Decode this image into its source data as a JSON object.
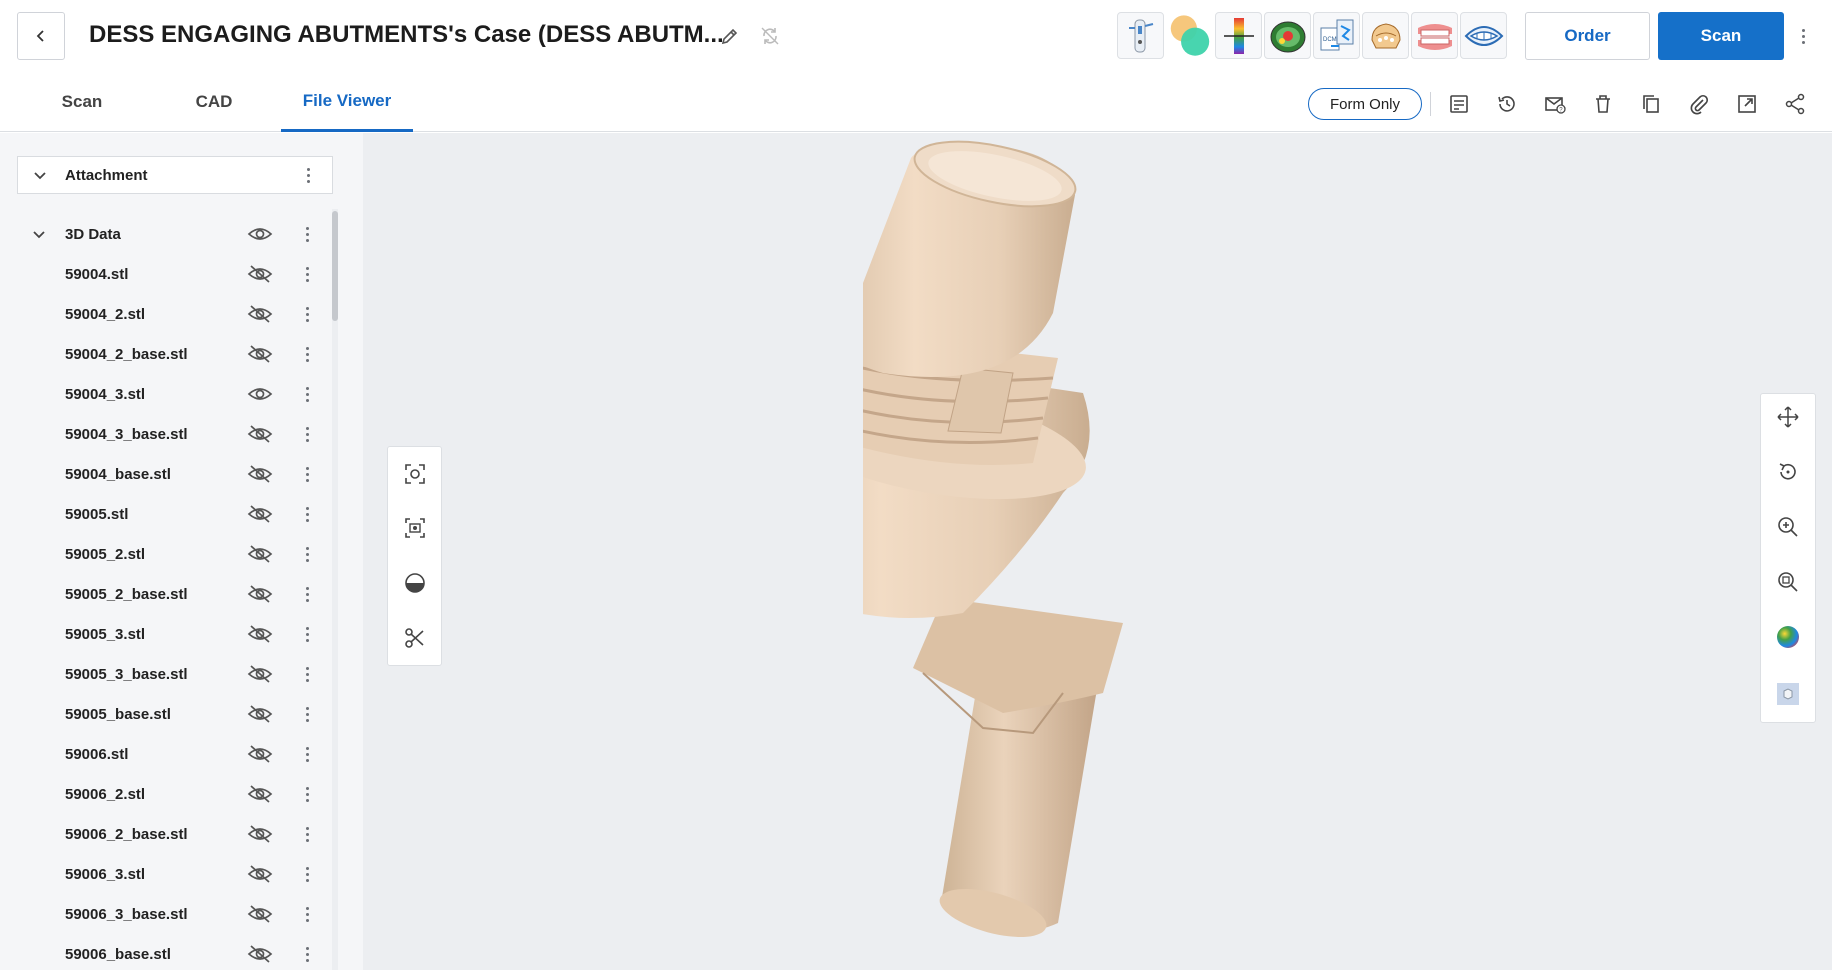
{
  "header": {
    "title": "DESS ENGAGING ABUTMENTS's Case (DESS ABUTM...",
    "order_label": "Order",
    "scan_label": "Scan",
    "apps": [
      "tooth-scan-app",
      "color-orbs-app",
      "spectrum-app",
      "heatmap-app",
      "dicom-app",
      "model-builder-app",
      "denture-app",
      "smile-app"
    ]
  },
  "tabs": [
    {
      "label": "Scan",
      "active": false
    },
    {
      "label": "CAD",
      "active": false
    },
    {
      "label": "File Viewer",
      "active": true
    }
  ],
  "toolbar": {
    "form_only_label": "Form Only",
    "icons": [
      "note-icon",
      "history-icon",
      "mail-icon",
      "trash-icon",
      "copy-icon",
      "attachment-icon",
      "open-external-icon",
      "share-icon"
    ]
  },
  "sidebar": {
    "attachment_label": "Attachment",
    "folder_label": "3D Data",
    "files": [
      {
        "name": "59004.stl",
        "visible": false
      },
      {
        "name": "59004_2.stl",
        "visible": false
      },
      {
        "name": "59004_2_base.stl",
        "visible": false
      },
      {
        "name": "59004_3.stl",
        "visible": true
      },
      {
        "name": "59004_3_base.stl",
        "visible": false
      },
      {
        "name": "59004_base.stl",
        "visible": false
      },
      {
        "name": "59005.stl",
        "visible": false
      },
      {
        "name": "59005_2.stl",
        "visible": false
      },
      {
        "name": "59005_2_base.stl",
        "visible": false
      },
      {
        "name": "59005_3.stl",
        "visible": false
      },
      {
        "name": "59005_3_base.stl",
        "visible": false
      },
      {
        "name": "59005_base.stl",
        "visible": false
      },
      {
        "name": "59006.stl",
        "visible": false
      },
      {
        "name": "59006_2.stl",
        "visible": false
      },
      {
        "name": "59006_2_base.stl",
        "visible": false
      },
      {
        "name": "59006_3.stl",
        "visible": false
      },
      {
        "name": "59006_3_base.stl",
        "visible": false
      },
      {
        "name": "59006_base.stl",
        "visible": false
      }
    ]
  },
  "viewer": {
    "left_tools": [
      "fit-view-icon",
      "screenshot-icon",
      "clipping-icon",
      "cut-icon"
    ],
    "right_tools": [
      "pan-icon",
      "rotate-icon",
      "zoom-in-icon",
      "zoom-area-icon",
      "color-map-icon",
      "cube-view-icon"
    ]
  },
  "colors": {
    "accent": "#1570c9",
    "model": "#e9d2b9"
  }
}
